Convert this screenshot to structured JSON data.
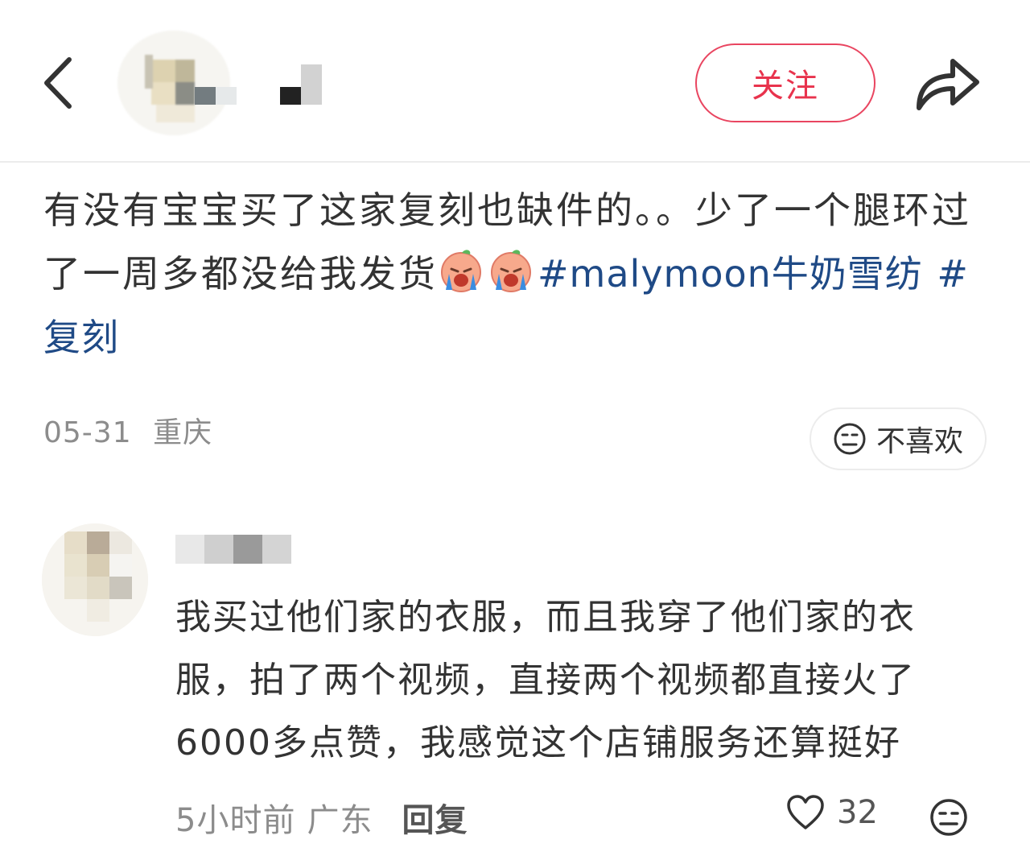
{
  "header": {
    "follow_label": "关注"
  },
  "post": {
    "text": "有没有宝宝买了这家复刻也缺件的。。少了一个腿环过了一周多都没给我发货",
    "emojis": [
      "crying-face-emoji",
      "crying-face-emoji"
    ],
    "tags": [
      "#malymoon牛奶雪纺",
      "#复刻"
    ],
    "date": "05-31",
    "location": "重庆",
    "dislike_label": "不喜欢"
  },
  "comment": {
    "text": "我买过他们家的衣服，而且我穿了他们家的衣服，拍了两个视频，直接两个视频都直接火了6000多点赞，我感觉这个店铺服务还算挺好",
    "time": "5小时前",
    "location": "广东",
    "reply_label": "回复",
    "likes": "32"
  },
  "colors": {
    "accent": "#e8334d",
    "tag": "#1f4a86",
    "meta": "#8c8c8c"
  }
}
